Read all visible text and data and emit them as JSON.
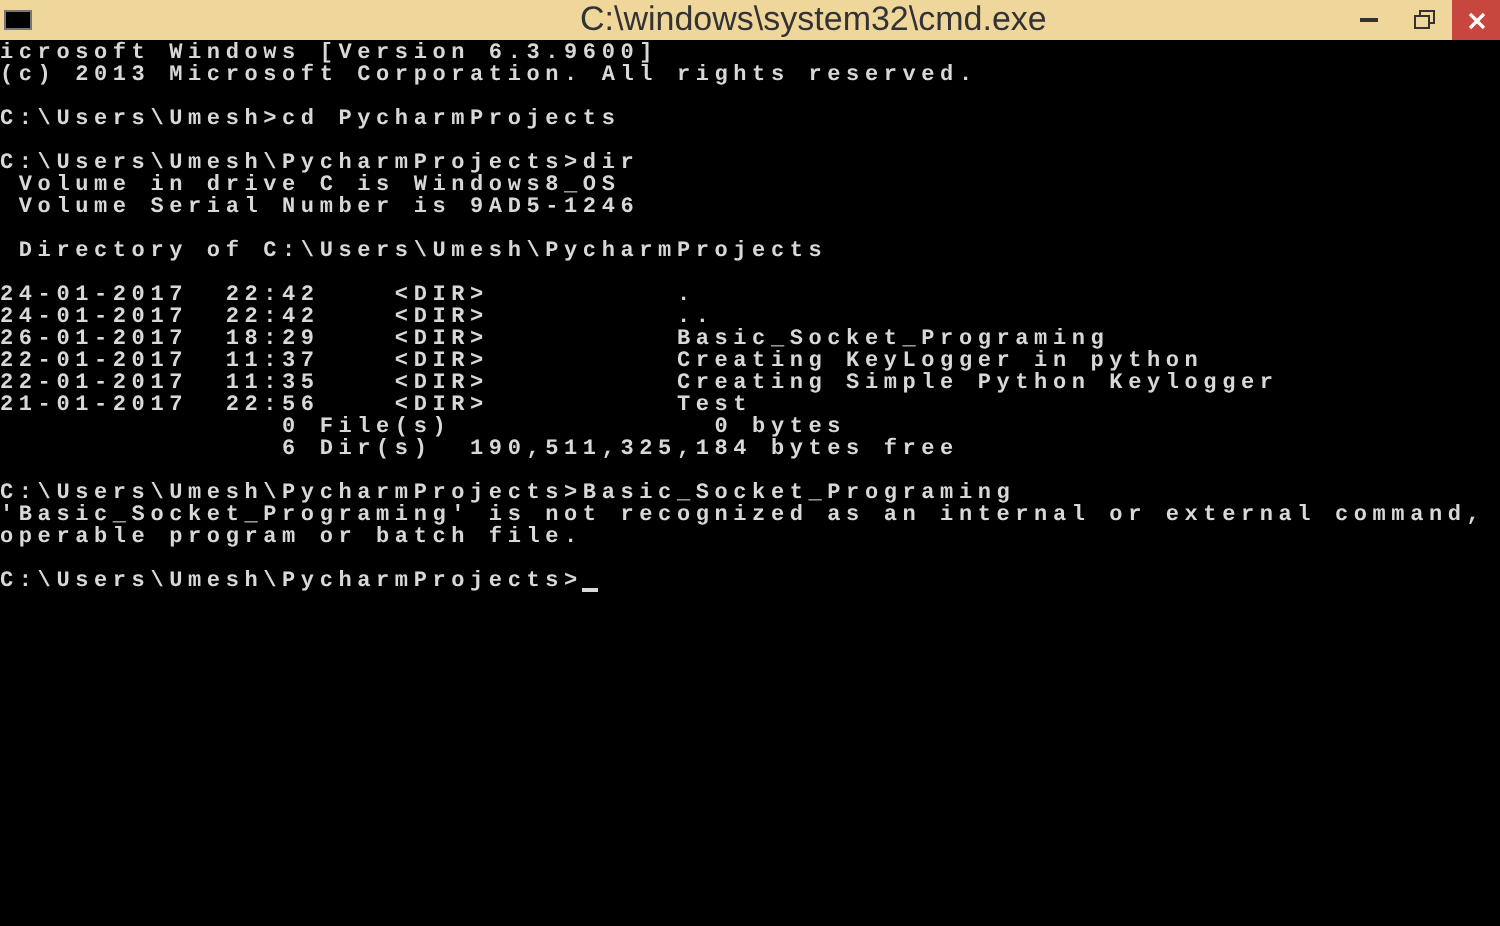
{
  "window": {
    "title": "C:\\windows\\system32\\cmd.exe"
  },
  "console": {
    "blocks": [
      [
        "icrosoft Windows [Version 6.3.9600]",
        "(c) 2013 Microsoft Corporation. All rights reserved."
      ],
      [
        "C:\\Users\\Umesh>cd PycharmProjects"
      ],
      [
        "C:\\Users\\Umesh\\PycharmProjects>dir",
        " Volume in drive C is Windows8_OS",
        " Volume Serial Number is 9AD5-1246"
      ],
      [
        " Directory of C:\\Users\\Umesh\\PycharmProjects"
      ],
      [
        "24-01-2017  22:42    <DIR>          .",
        "24-01-2017  22:42    <DIR>          ..",
        "26-01-2017  18:29    <DIR>          Basic_Socket_Programing",
        "22-01-2017  11:37    <DIR>          Creating KeyLogger in python",
        "22-01-2017  11:35    <DIR>          Creating Simple Python Keylogger",
        "21-01-2017  22:56    <DIR>          Test",
        "               0 File(s)              0 bytes",
        "               6 Dir(s)  190,511,325,184 bytes free"
      ],
      [
        "C:\\Users\\Umesh\\PycharmProjects>Basic_Socket_Programing",
        "'Basic_Socket_Programing' is not recognized as an internal or external command,",
        "operable program or batch file."
      ],
      [
        "C:\\Users\\Umesh\\PycharmProjects>"
      ]
    ]
  }
}
